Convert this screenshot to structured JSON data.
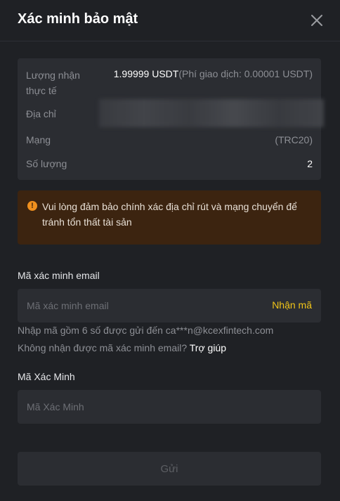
{
  "header": {
    "title": "Xác minh bảo mật"
  },
  "summary": {
    "received_label_line1": "Lượng nhận",
    "received_label_line2": "thực tế",
    "received_amount": "1.99999 USDT",
    "received_fee": "(Phí giao dịch: 0.00001 USDT)",
    "address_label": "Địa chỉ",
    "network_label": "Mạng",
    "network_value": "(TRC20)",
    "quantity_label": "Số lượng",
    "quantity_value": "2"
  },
  "warning": {
    "icon": "info-icon",
    "text": "Vui lòng đảm bảo chính xác địa chỉ rút và mạng chuyển để tránh tổn thất tài sản",
    "color": "#3c2410"
  },
  "email_verification": {
    "label": "Mã xác minh email",
    "placeholder": "Mã xác minh email",
    "value": "",
    "get_code": "Nhận mã",
    "hint": "Nhập mã gồm 6 số được gửi đến ca***n@kcexfintech.com",
    "not_received": "Không nhận được mã xác minh email?",
    "help": "Trợ giúp"
  },
  "verification_code": {
    "label": "Mã Xác Minh",
    "placeholder": "Mã Xác Minh",
    "value": ""
  },
  "submit": {
    "label": "Gửi"
  },
  "colors": {
    "accent": "#f0c419",
    "background": "#1f2125",
    "panel": "#2b2d32",
    "warning_icon": "#f0901e"
  }
}
